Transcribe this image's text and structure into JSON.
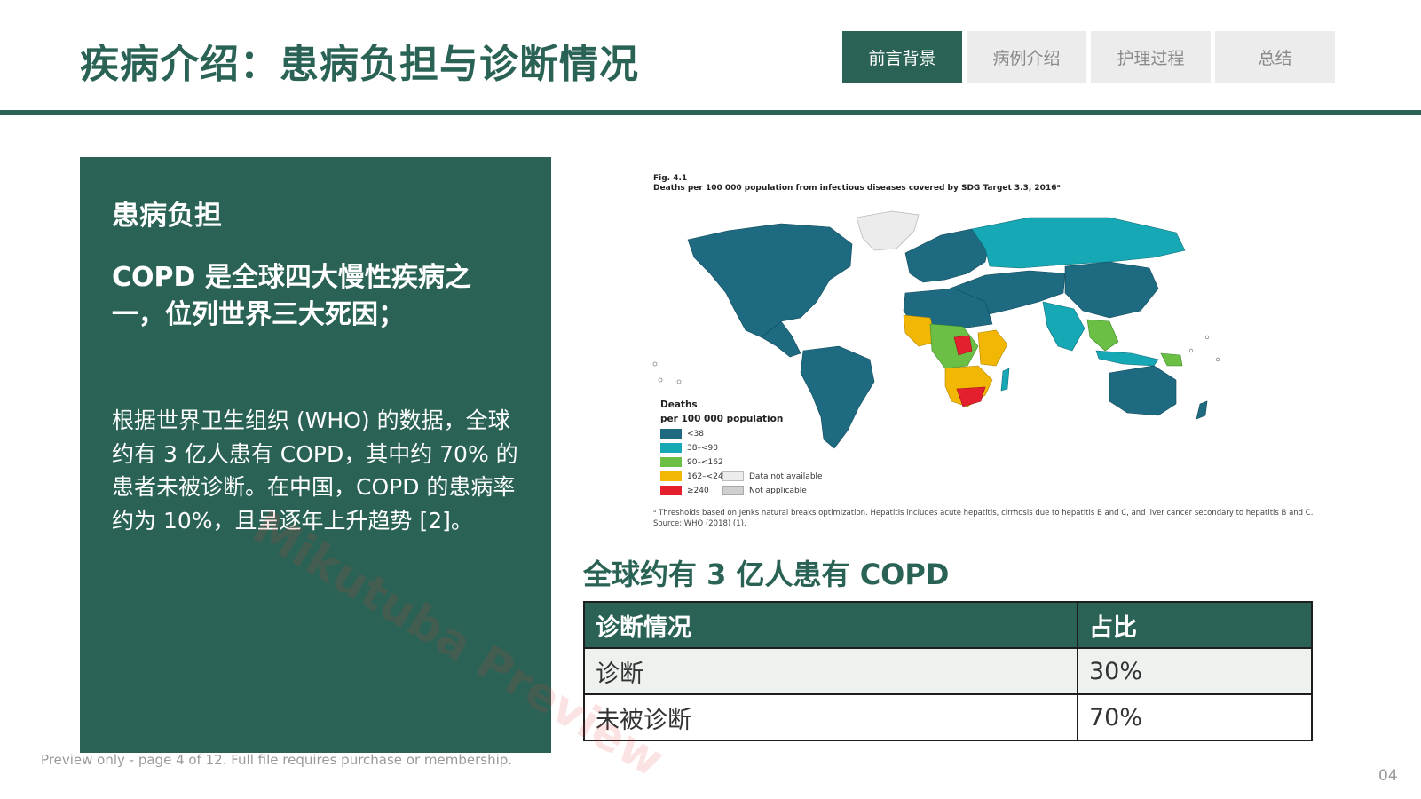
{
  "header": {
    "title": "疾病介绍：患病负担与诊断情况",
    "tabs": [
      {
        "label": "前言背景",
        "active": true
      },
      {
        "label": "病例介绍",
        "active": false
      },
      {
        "label": "护理过程",
        "active": false
      },
      {
        "label": "总结",
        "active": false
      }
    ]
  },
  "left_panel": {
    "heading": "患病负担",
    "lead": "COPD 是全球四大慢性疾病之一，位列世界三大死因；",
    "body": "根据世界卫生组织 (WHO) 的数据，全球约有 3 亿人患有 COPD，其中约 70% 的患者未被诊断。在中国，COPD 的患病率约为 10%，且呈逐年上升趋势 [2]。"
  },
  "figure": {
    "caption_line1": "Fig. 4.1",
    "caption_line2": "Deaths per 100 000 population from infectious diseases covered by SDG Target 3.3, 2016ᵃ",
    "legend_title_1": "Deaths",
    "legend_title_2": "per 100 000 population",
    "legend_items": [
      {
        "label": "<38",
        "color": "#1e6a80"
      },
      {
        "label": "38–<90",
        "color": "#17a8b5"
      },
      {
        "label": "90–<162",
        "color": "#6cbf45"
      },
      {
        "label": "162–<240",
        "color": "#f2b705"
      },
      {
        "label": "≥240",
        "color": "#e4202e"
      }
    ],
    "legend_other": [
      {
        "label": "Data not available",
        "color": "#ececec"
      },
      {
        "label": "Not applicable",
        "color": "#d0d0d0"
      }
    ],
    "footnote_1": "ᵃ Thresholds based on Jenks natural breaks optimization. Hepatitis includes acute hepatitis, cirrhosis due to hepatitis B and C, and liver cancer secondary to hepatitis B and C.",
    "footnote_2": "Source: WHO (2018) (1)."
  },
  "table": {
    "caption": "全球约有 3 亿人患有 COPD",
    "headers": [
      "诊断情况",
      "占比"
    ],
    "rows": [
      [
        "诊断",
        "30%"
      ],
      [
        "未被诊断",
        "70%"
      ]
    ]
  },
  "watermark": "Mikutuba Preview",
  "preview_notice": "Preview only - page 4 of 12. Full file requires purchase or membership.",
  "page_number": "04"
}
